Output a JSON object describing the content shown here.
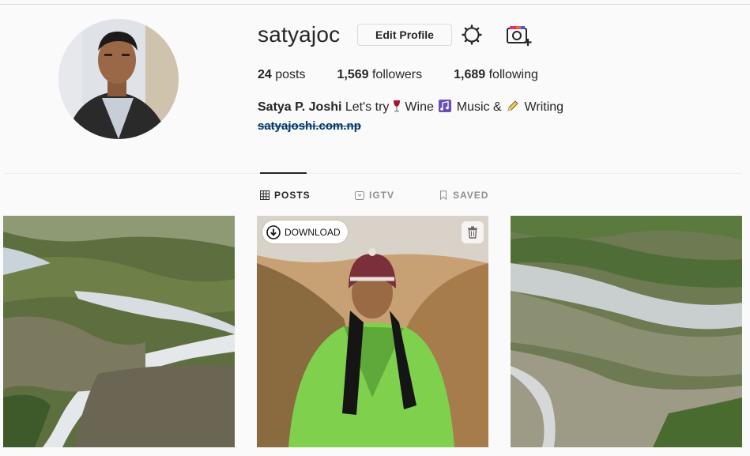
{
  "profile": {
    "username": "satyajoc",
    "edit_label": "Edit Profile",
    "posts_count": "24",
    "posts_label": " posts",
    "followers_count": "1,569",
    "followers_label": " followers",
    "following_count": "1,689",
    "following_label": " following",
    "full_name": "Satya P. Joshi",
    "bio_part1": " Let's try",
    "bio_part2": "Wine ",
    "bio_part3": " Music & ",
    "bio_part4": " Writing",
    "bio_emojis": [
      "wine-glass-icon",
      "musical-notes-icon",
      "pencil-icon"
    ],
    "website": "satyajoshi.com.np"
  },
  "tabs": [
    {
      "label": "POSTS",
      "icon": "grid-icon",
      "active": true
    },
    {
      "label": "IGTV",
      "icon": "igtv-icon",
      "active": false
    },
    {
      "label": "SAVED",
      "icon": "bookmark-icon",
      "active": false
    }
  ],
  "post_overlay": {
    "download_label": "DOWNLOAD",
    "download_icon": "download-icon",
    "delete_icon": "trash-icon"
  },
  "colors": {
    "background": "#fafafa",
    "text": "#262626",
    "muted": "#8e8e8e",
    "link": "#003569"
  }
}
